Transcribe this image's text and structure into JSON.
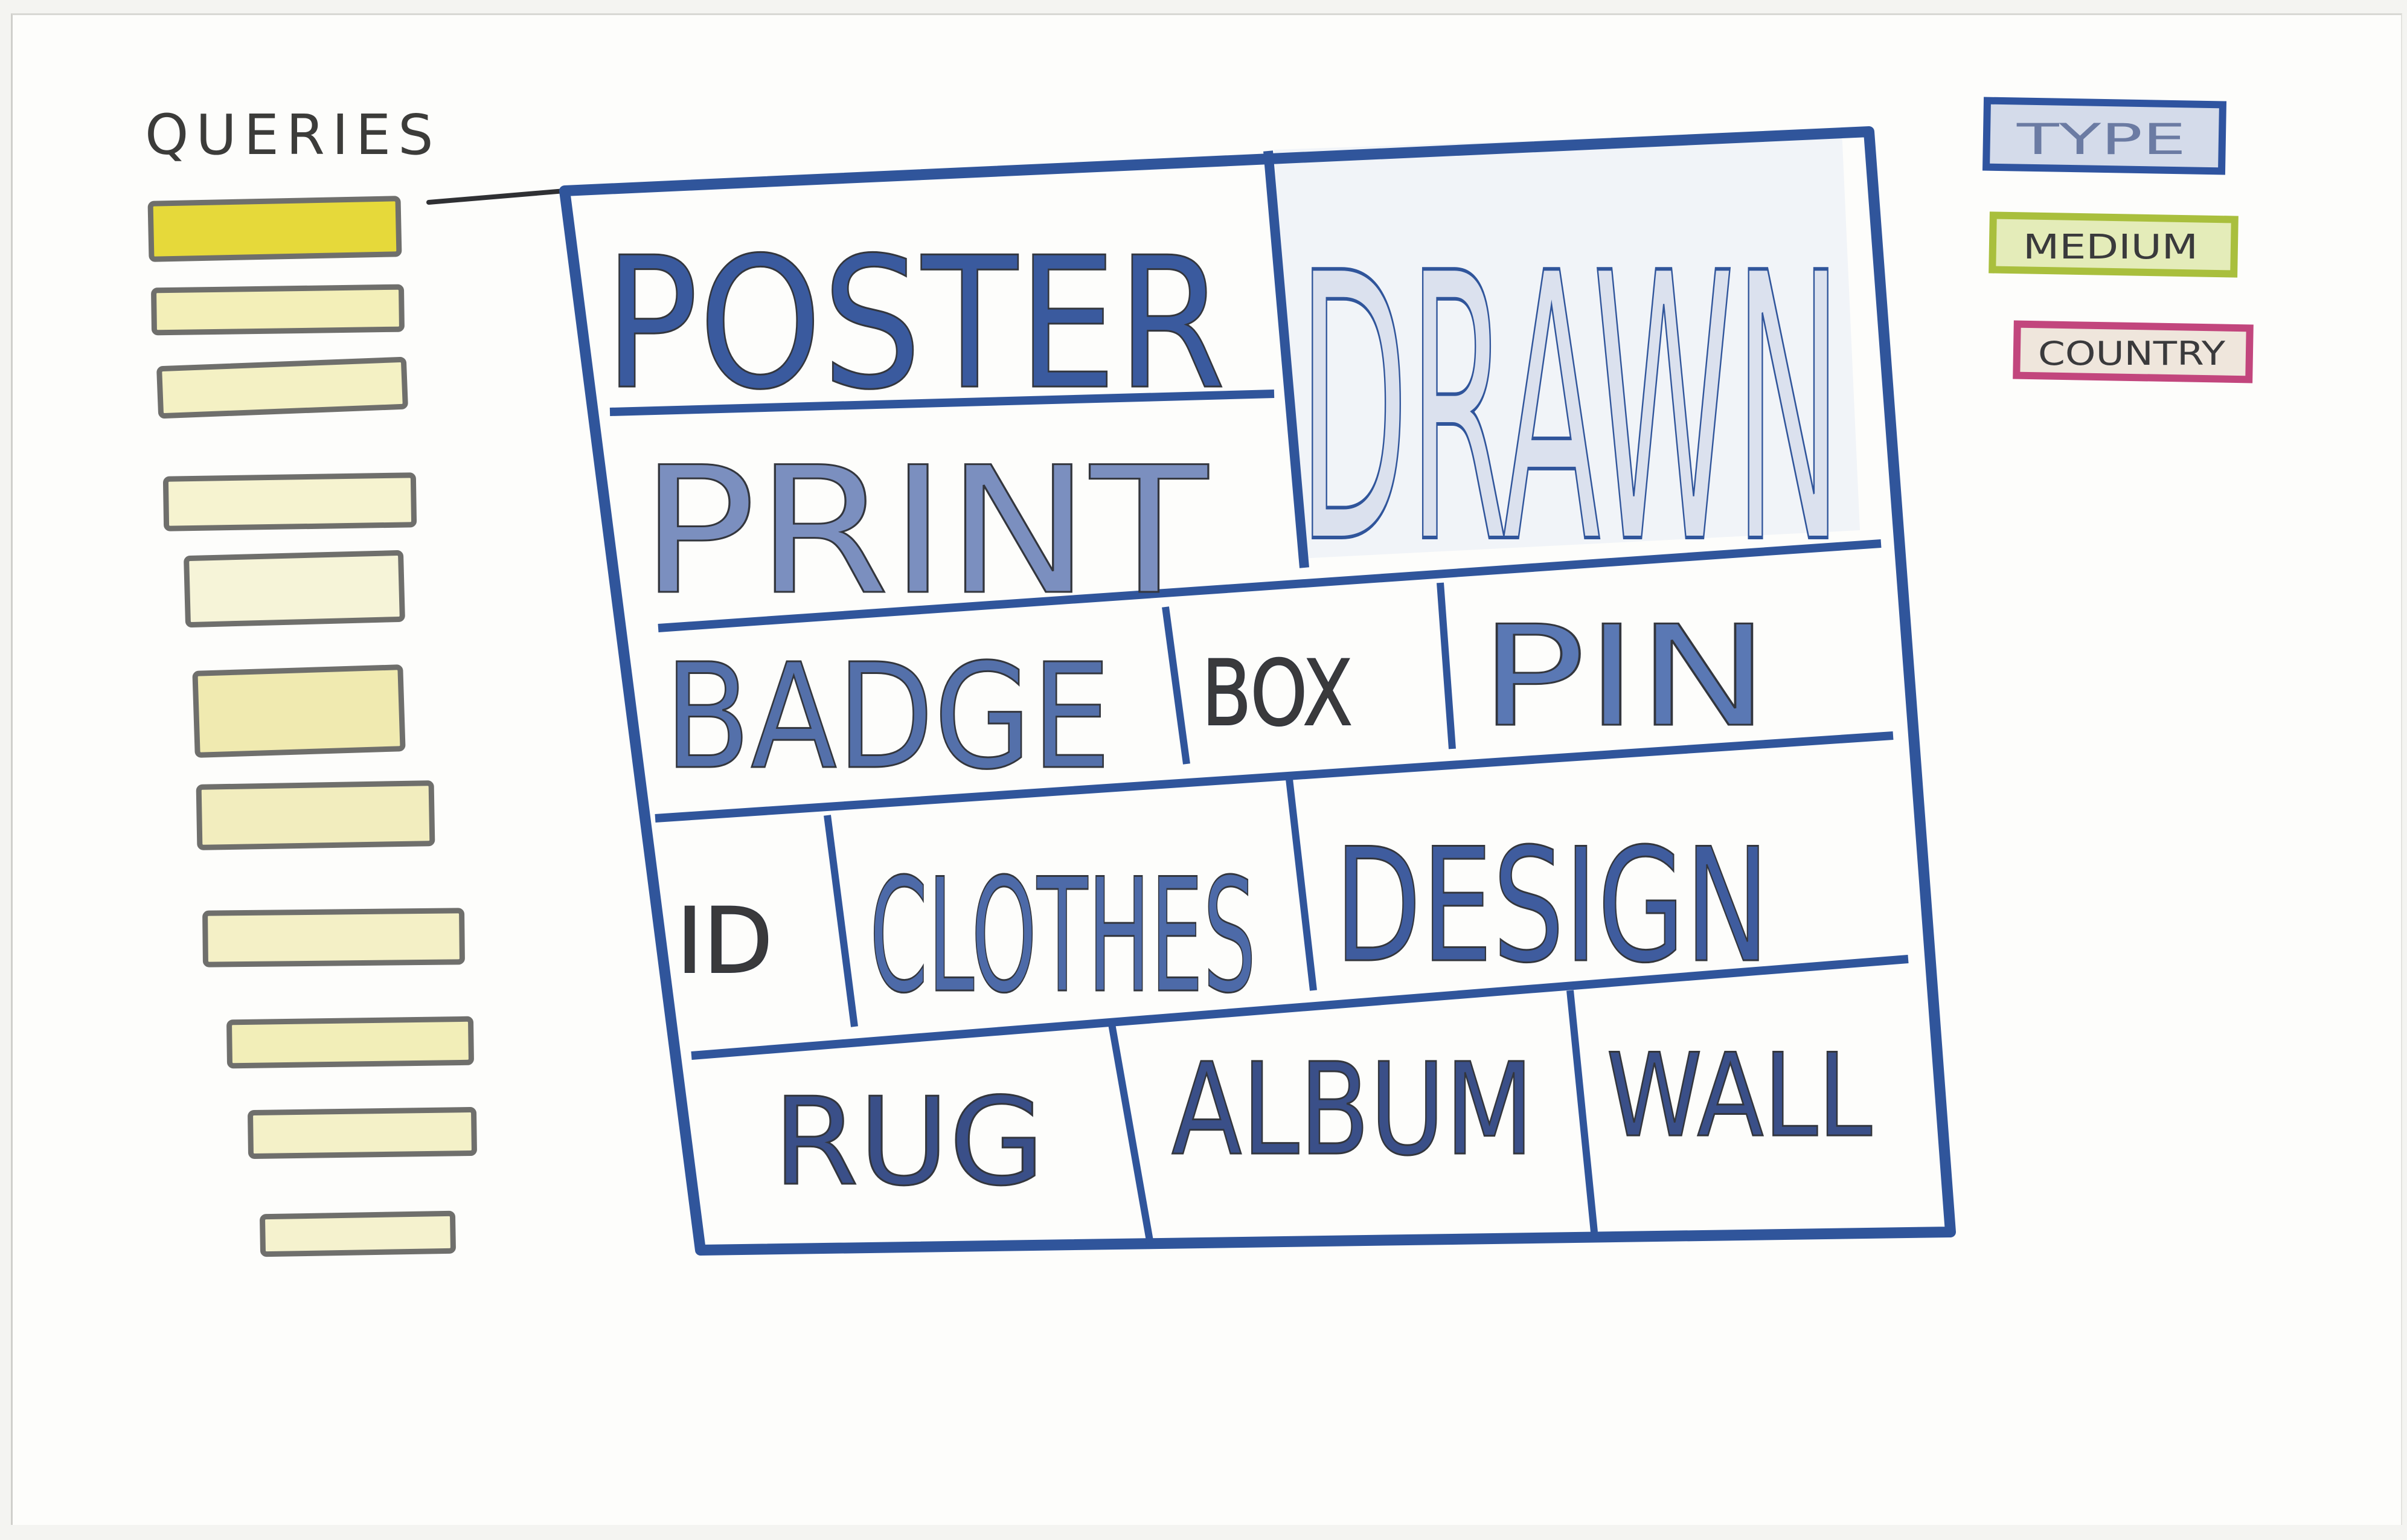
{
  "queries": {
    "title": "QUERIES",
    "bar_count": 11,
    "colors": {
      "bar_stroke": "#6f6f6c",
      "bar_top_fill": "#e6d93a",
      "bar_fill": "#f1edb5"
    }
  },
  "treemap": {
    "cells": [
      {
        "id": "poster",
        "label": "POSTER"
      },
      {
        "id": "print",
        "label": "PRINT"
      },
      {
        "id": "drawn",
        "label": "DRAWN"
      },
      {
        "id": "badge",
        "label": "BADGE"
      },
      {
        "id": "box",
        "label": "BOX"
      },
      {
        "id": "pin",
        "label": "PIN"
      },
      {
        "id": "id",
        "label": "ID"
      },
      {
        "id": "clothes",
        "label": "CLOTHES"
      },
      {
        "id": "design",
        "label": "DESIGN"
      },
      {
        "id": "rug",
        "label": "RUG"
      },
      {
        "id": "album",
        "label": "ALBUM"
      },
      {
        "id": "wall",
        "label": "WALL"
      }
    ],
    "colors": {
      "border": "#30559b",
      "ink": "#33363d",
      "fill_blue": "#8fa4cf"
    }
  },
  "legend": {
    "items": [
      {
        "id": "type",
        "label": "TYPE",
        "color": "#2f54a0"
      },
      {
        "id": "medium",
        "label": "MEDIUM",
        "color": "#a9bf3d"
      },
      {
        "id": "country",
        "label": "COUNTRY",
        "color": "#c2467d"
      }
    ]
  }
}
